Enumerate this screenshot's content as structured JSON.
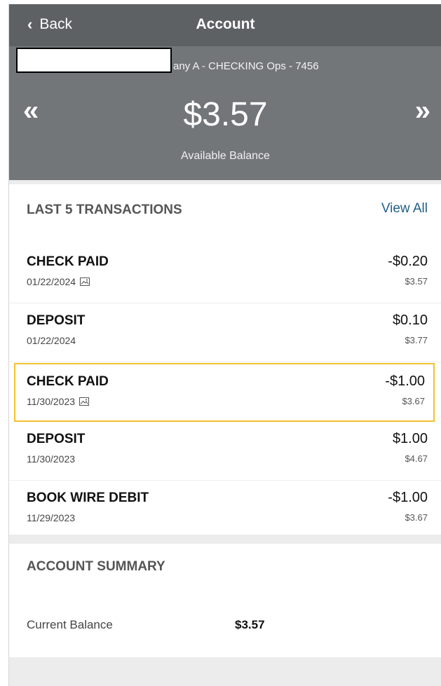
{
  "header": {
    "back_label": "Back",
    "title": "Account"
  },
  "balance": {
    "account_name": "any A - CHECKING Ops - 7456",
    "amount": "$3.57",
    "caption": "Available Balance",
    "prev_glyph": "«",
    "next_glyph": "»"
  },
  "transactions": {
    "title": "LAST 5 TRANSACTIONS",
    "view_all": "View All",
    "items": [
      {
        "type": "CHECK PAID",
        "date": "01/22/2024",
        "has_image": true,
        "amount": "-$0.20",
        "balance": "$3.57"
      },
      {
        "type": "DEPOSIT",
        "date": "01/22/2024",
        "has_image": false,
        "amount": "$0.10",
        "balance": "$3.77"
      },
      {
        "type": "CHECK PAID",
        "date": "11/30/2023",
        "has_image": true,
        "amount": "-$1.00",
        "balance": "$3.67"
      },
      {
        "type": "DEPOSIT",
        "date": "11/30/2023",
        "has_image": false,
        "amount": "$1.00",
        "balance": "$4.67"
      },
      {
        "type": "BOOK WIRE DEBIT",
        "date": "11/29/2023",
        "has_image": false,
        "amount": "-$1.00",
        "balance": "$3.67"
      }
    ]
  },
  "summary": {
    "title": "ACCOUNT SUMMARY",
    "current_label": "Current Balance",
    "current_value": "$3.57"
  },
  "colors": {
    "header_bg": "#5e6164",
    "balance_bg": "#737679",
    "link": "#1f5f86",
    "highlight": "#f2c230"
  }
}
